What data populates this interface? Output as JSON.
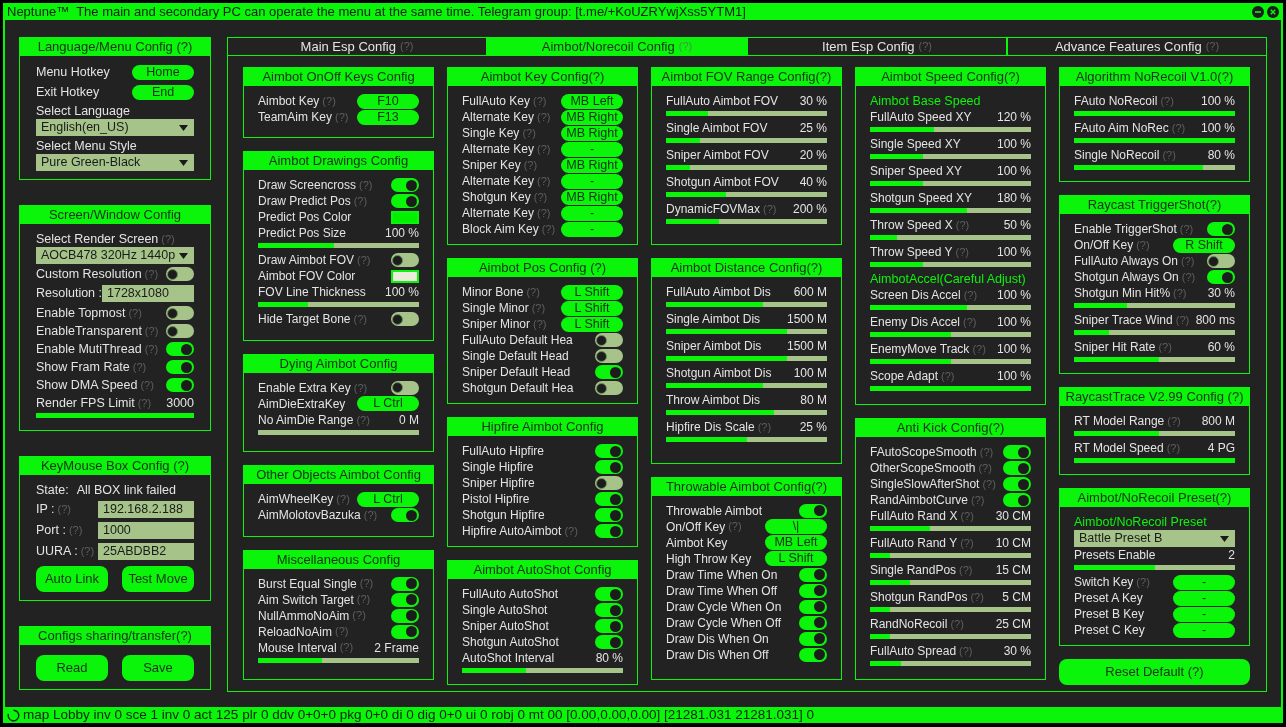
{
  "title_bar": {
    "text": "Neptune™  The main and secondary PC can operate the menu at the same time. Telegram group: [t.me/+KoUZRYwjXss5YTM1]"
  },
  "sidebar": {
    "panels": [
      {
        "title": "Language/Menu Config (?)",
        "rows": [
          {
            "kind": "key",
            "label": "Menu Hotkey",
            "value": "Home"
          },
          {
            "kind": "key",
            "label": "Exit Hotkey",
            "value": "End"
          },
          {
            "kind": "dropdown",
            "label": "Select Language",
            "value": "English(en_US)"
          },
          {
            "kind": "dropdown",
            "label": "Select Menu Style",
            "value": "Pure Green-Black"
          }
        ]
      },
      {
        "title": "Screen/Window Config",
        "rows": [
          {
            "kind": "dropdown",
            "label": "Select Render Screen",
            "hint": "(?)",
            "value": "AOCB478 320Hz 1440p"
          },
          {
            "kind": "toggle",
            "label": "Custom Resolution",
            "hint": "(?)",
            "on": false
          },
          {
            "kind": "field",
            "label": "Resolution :",
            "value": "1728x1080"
          },
          {
            "kind": "toggle",
            "label": "Enable Topmost",
            "hint": "(?)",
            "on": false
          },
          {
            "kind": "toggle",
            "label": "EnableTransparent",
            "hint": "(?)",
            "on": false
          },
          {
            "kind": "toggle",
            "label": "Enable MutiThread",
            "hint": "(?)",
            "on": true
          },
          {
            "kind": "toggle",
            "label": "Show Fram Rate",
            "hint": "(?)",
            "on": true
          },
          {
            "kind": "toggle",
            "label": "Show DMA Speed",
            "hint": "(?)",
            "on": true
          },
          {
            "kind": "slider",
            "label": "Render FPS Limit",
            "hint": "(?)",
            "reading": "3000",
            "level": 1
          }
        ]
      },
      {
        "title": "KeyMouse Box Config (?)",
        "rows": [
          {
            "kind": "text",
            "label": "State:",
            "value": "All BOX link failed"
          },
          {
            "kind": "field",
            "label": "IP :",
            "hint": "(?)",
            "value": "192.168.2.188"
          },
          {
            "kind": "field",
            "label": "Port :",
            "hint": "(?)",
            "value": "1000"
          },
          {
            "kind": "field",
            "label": "UURA :",
            "hint": "(?)",
            "value": "25ABDBB2"
          },
          {
            "kind": "buttons",
            "labels": [
              "Auto Link",
              "Test Move"
            ]
          }
        ]
      },
      {
        "title": "Configs sharing/transfer(?)",
        "rows": [
          {
            "kind": "buttons",
            "labels": [
              "Read",
              "Save"
            ]
          }
        ]
      }
    ]
  },
  "tabs": [
    {
      "label": "Main Esp Config",
      "hint": "(?)",
      "selected": false
    },
    {
      "label": "Aimbot/Norecoil Config",
      "hint": "(?)",
      "selected": true
    },
    {
      "label": "Item Esp Config",
      "hint": "(?)",
      "selected": false
    },
    {
      "label": "Advance Features Config",
      "hint": "(?)",
      "selected": false
    }
  ],
  "columns": [
    {
      "items": [
        {
          "kind": "panel",
          "title": "Aimbot OnOff Keys Config",
          "rows": [
            {
              "kind": "key",
              "label": "Aimbot Key",
              "hint": "(?)",
              "value": "F10"
            },
            {
              "kind": "key",
              "label": "TeamAim Key",
              "hint": "(?)",
              "value": "F13"
            }
          ]
        },
        {
          "kind": "panel",
          "title": "Aimbot Drawings Config",
          "rows": [
            {
              "kind": "toggle",
              "label": "Draw Screencross",
              "hint": "(?)",
              "on": true
            },
            {
              "kind": "toggle",
              "label": "Draw Predict Pos",
              "hint": "(?)",
              "on": true
            },
            {
              "kind": "color",
              "label": "Predict Pos Color",
              "color": "#00f000"
            },
            {
              "kind": "slider",
              "label": "Predict Pos Size",
              "reading": "100 %",
              "level": 0.47
            },
            {
              "kind": "toggle",
              "label": "Draw Aimbot FOV",
              "hint": "(?)",
              "on": false
            },
            {
              "kind": "color",
              "label": "Aimbot FOV Color",
              "color": "#ecebdc"
            },
            {
              "kind": "slider",
              "label": "FOV Line Thickness",
              "reading": "100 %",
              "level": 0.31
            },
            {
              "kind": "toggle",
              "label": "Hide Target Bone",
              "hint": "(?)",
              "on": false
            }
          ]
        },
        {
          "kind": "panel",
          "title": "Dying Aimbot Config",
          "rows": [
            {
              "kind": "toggle",
              "label": "Enable Extra Key",
              "hint": "(?)",
              "on": false
            },
            {
              "kind": "key",
              "label": "AimDieExtraKey",
              "value": "L Ctrl"
            },
            {
              "kind": "slider",
              "label": "No AimDie Range",
              "hint": "(?)",
              "reading": "0 M",
              "level": 0
            }
          ]
        },
        {
          "kind": "panel",
          "title": "Other Objects Aimbot Config",
          "rows": [
            {
              "kind": "key",
              "label": "AimWheelKey",
              "hint": "(?)",
              "value": "L Ctrl"
            },
            {
              "kind": "toggle",
              "label": "AimMolotovBazuka",
              "hint": "(?)",
              "on": true
            }
          ]
        },
        {
          "kind": "panel",
          "title": "Miscellaneous Config",
          "rows": [
            {
              "kind": "toggle",
              "label": "Burst Equal Single",
              "hint": "(?)",
              "on": true
            },
            {
              "kind": "toggle",
              "label": "Aim Switch Target",
              "hint": "(?)",
              "on": true
            },
            {
              "kind": "toggle",
              "label": "NullAmmoNoAim",
              "hint": "(?)",
              "on": true
            },
            {
              "kind": "toggle",
              "label": "ReloadNoAim",
              "hint": "(?)",
              "on": true
            },
            {
              "kind": "slider",
              "label": "Mouse Interval",
              "hint": "(?)",
              "reading": "2 Frame",
              "level": 0.4
            }
          ]
        }
      ]
    },
    {
      "items": [
        {
          "kind": "panel",
          "title": "Aimbot Key Config(?)",
          "rows": [
            {
              "kind": "key",
              "label": "FullAuto Key",
              "hint": "(?)",
              "value": "MB Left"
            },
            {
              "kind": "key",
              "label": "Alternate Key",
              "hint": "(?)",
              "value": "MB Right"
            },
            {
              "kind": "key",
              "label": "Single Key",
              "hint": "(?)",
              "value": "MB Right"
            },
            {
              "kind": "key",
              "label": "Alternate Key",
              "hint": "(?)",
              "value": "-"
            },
            {
              "kind": "key",
              "label": "Sniper Key",
              "hint": "(?)",
              "value": "MB Right"
            },
            {
              "kind": "key",
              "label": "Alternate Key",
              "hint": "(?)",
              "value": "-"
            },
            {
              "kind": "key",
              "label": "Shotgun Key",
              "hint": "(?)",
              "value": "MB Right"
            },
            {
              "kind": "key",
              "label": "Alternate Key",
              "hint": "(?)",
              "value": "-"
            },
            {
              "kind": "key",
              "label": "Block Aim Key",
              "hint": "(?)",
              "value": "-"
            }
          ]
        },
        {
          "kind": "panel",
          "title": "Aimbot Pos Config (?)",
          "rows": [
            {
              "kind": "key",
              "label": "Minor Bone",
              "hint": "(?)",
              "value": "L Shift"
            },
            {
              "kind": "key",
              "label": "Single Minor",
              "hint": "(?)",
              "value": "L Shift"
            },
            {
              "kind": "key",
              "label": "Sniper Minor",
              "hint": "(?)",
              "value": "L Shift"
            },
            {
              "kind": "toggle",
              "label": "FullAuto Default Hea",
              "on": false
            },
            {
              "kind": "toggle",
              "label": "Single Default Head",
              "on": false
            },
            {
              "kind": "toggle",
              "label": "Sniper Default Head",
              "on": true
            },
            {
              "kind": "toggle",
              "label": "Shotgun Default Hea",
              "on": false
            }
          ]
        },
        {
          "kind": "panel",
          "title": "Hipfire Aimbot Config",
          "rows": [
            {
              "kind": "toggle",
              "label": "FullAuto Hipfire",
              "on": true
            },
            {
              "kind": "toggle",
              "label": "Single Hipfire",
              "on": true
            },
            {
              "kind": "toggle",
              "label": "Sniper Hipfire",
              "on": false
            },
            {
              "kind": "toggle",
              "label": "Pistol Hipfire",
              "on": true
            },
            {
              "kind": "toggle",
              "label": "Shotgun Hipfire",
              "on": true
            },
            {
              "kind": "toggle",
              "label": "Hipfire AutoAimbot",
              "hint": "(?)",
              "on": true
            }
          ]
        },
        {
          "kind": "panel",
          "title": "Aimbot AutoShot Config",
          "rows": [
            {
              "kind": "toggle",
              "label": "FullAuto AutoShot",
              "on": true
            },
            {
              "kind": "toggle",
              "label": "Single AutoShot",
              "on": true
            },
            {
              "kind": "toggle",
              "label": "Sniper AutoShot",
              "on": true
            },
            {
              "kind": "toggle",
              "label": "Shotgun AutoShot",
              "on": true
            },
            {
              "kind": "slider",
              "label": "AutoShot Interval",
              "reading": "80 %",
              "level": 0.4
            }
          ]
        }
      ]
    },
    {
      "items": [
        {
          "kind": "panel",
          "title": "Aimbot FOV Range Config(?)",
          "rows": [
            {
              "kind": "slider",
              "label": "FullAuto Aimbot FOV",
              "reading": "30 %",
              "level": 0.26
            },
            {
              "kind": "slider",
              "label": "Single Aimbot FOV",
              "reading": "25 %",
              "level": 0.21
            },
            {
              "kind": "slider",
              "label": "Sniper Aimbot FOV",
              "reading": "20 %",
              "level": 0.15
            },
            {
              "kind": "slider",
              "label": "Shotgun Aimbot FOV",
              "reading": "40 %",
              "level": 0.37
            },
            {
              "kind": "slider",
              "label": "DynamicFOVMax",
              "hint": "(?)",
              "reading": "200 %",
              "level": 0.33
            }
          ]
        },
        {
          "kind": "panel",
          "title": "Aimbot Distance Config(?)",
          "rows": [
            {
              "kind": "slider",
              "label": "FullAuto Aimbot Dis",
              "reading": "600 M",
              "level": 0.6
            },
            {
              "kind": "slider",
              "label": "Single Aimbot Dis",
              "reading": "1500 M",
              "level": 0.75
            },
            {
              "kind": "slider",
              "label": "Sniper Aimbot Dis",
              "reading": "1500 M",
              "level": 0.75
            },
            {
              "kind": "slider",
              "label": "Shotgun Aimbot Dis",
              "reading": "100 M",
              "level": 0.6
            },
            {
              "kind": "slider",
              "label": "Throw Aimbot Dis",
              "reading": "80 M",
              "level": 0.67
            },
            {
              "kind": "slider",
              "label": "Hipfire Dis Scale",
              "hint": "(?)",
              "reading": "25 %",
              "level": 0.5
            }
          ]
        },
        {
          "kind": "panel",
          "title": "Throwable Aimbot Config(?)",
          "rows": [
            {
              "kind": "toggle",
              "label": "Throwable Aimbot",
              "on": true
            },
            {
              "kind": "key",
              "label": "On/Off Key",
              "hint": "(?)",
              "value": "\\|"
            },
            {
              "kind": "key",
              "label": "Aimbot Key",
              "value": "MB Left"
            },
            {
              "kind": "key",
              "label": "High Throw Key",
              "value": "L Shift"
            },
            {
              "kind": "toggle",
              "label": "Draw Time When On",
              "on": true
            },
            {
              "kind": "toggle",
              "label": "Draw Time When Off",
              "on": true
            },
            {
              "kind": "toggle",
              "label": "Draw Cycle When On",
              "on": true
            },
            {
              "kind": "toggle",
              "label": "Draw Cycle When Off",
              "on": true
            },
            {
              "kind": "toggle",
              "label": "Draw Dis When On",
              "on": true
            },
            {
              "kind": "toggle",
              "label": "Draw Dis When Off",
              "on": true
            }
          ]
        }
      ]
    },
    {
      "items": [
        {
          "kind": "panel",
          "title": "Aimbot Speed Config(?)",
          "rows": [
            {
              "kind": "section",
              "text": "Aimbot Base Speed"
            },
            {
              "kind": "slider",
              "label": "FullAuto Speed XY",
              "reading": "120 %",
              "level": 0.4
            },
            {
              "kind": "slider",
              "label": "Single Speed XY",
              "reading": "100 %",
              "level": 0.33
            },
            {
              "kind": "slider",
              "label": "Sniper Speed XY",
              "reading": "100 %",
              "level": 0.33
            },
            {
              "kind": "slider",
              "label": "Shotgun Speed XY",
              "reading": "180 %",
              "level": 0.6
            },
            {
              "kind": "slider",
              "label": "Throw Speed X",
              "hint": "(?)",
              "reading": "50 %",
              "level": 0.17
            },
            {
              "kind": "slider",
              "label": "Throw Speed Y",
              "hint": "(?)",
              "reading": "100 %",
              "level": 0.33
            },
            {
              "kind": "section",
              "text": "AimbotAccel(Careful Adjust)"
            },
            {
              "kind": "slider",
              "label": "Screen Dis Accel",
              "hint": "(?)",
              "reading": "100 %",
              "level": 0.6
            },
            {
              "kind": "slider",
              "label": "Enemy Dis Accel",
              "hint": "(?)",
              "reading": "100 %",
              "level": 0.5
            },
            {
              "kind": "slider",
              "label": "EnemyMove Track",
              "hint": "(?)",
              "reading": "100 %",
              "level": 0.5
            },
            {
              "kind": "slider",
              "label": "Scope Adapt",
              "hint": "(?)",
              "reading": "100 %",
              "level": 1
            }
          ]
        },
        {
          "kind": "panel",
          "title": "Anti Kick Config(?)",
          "rows": [
            {
              "kind": "toggle",
              "label": "FAutoScopeSmooth",
              "hint": "(?)",
              "on": true
            },
            {
              "kind": "toggle",
              "label": "OtherScopeSmooth",
              "hint": "(?)",
              "on": true
            },
            {
              "kind": "toggle",
              "label": "SingleSlowAfterShot",
              "hint": "(?)",
              "on": true
            },
            {
              "kind": "toggle",
              "label": "RandAimbotCurve",
              "hint": "(?)",
              "on": true
            },
            {
              "kind": "slider",
              "label": "FullAuto Rand X",
              "hint": "(?)",
              "reading": "30 CM",
              "level": 0.375
            },
            {
              "kind": "slider",
              "label": "FullAuto Rand Y",
              "hint": "(?)",
              "reading": "10 CM",
              "level": 0.125
            },
            {
              "kind": "slider",
              "label": "Single RandPos",
              "hint": "(?)",
              "reading": "15 CM",
              "level": 0.25
            },
            {
              "kind": "slider",
              "label": "Shotgun RandPos",
              "hint": "(?)",
              "reading": "5 CM",
              "level": 0.125
            },
            {
              "kind": "slider",
              "label": "RandNoRecoil",
              "hint": "(?)",
              "reading": "25 CM",
              "level": 0.125
            },
            {
              "kind": "slider",
              "label": "FullAuto Spread",
              "hint": "(?)",
              "reading": "30 %",
              "level": 0.19
            }
          ]
        }
      ]
    },
    {
      "items": [
        {
          "kind": "panel",
          "title": "Algorithm NoRecoil V1.0(?)",
          "rows": [
            {
              "kind": "slider",
              "label": "FAuto NoRecoil",
              "hint": "(?)",
              "reading": "100 %",
              "level": 1
            },
            {
              "kind": "slider",
              "label": "FAuto Aim NoRec",
              "hint": "(?)",
              "reading": "100 %",
              "level": 1
            },
            {
              "kind": "slider",
              "label": "Single NoRecoil",
              "hint": "(?)",
              "reading": "80 %",
              "level": 0.8
            }
          ]
        },
        {
          "kind": "panel",
          "title": "Raycast TriggerShot(?)",
          "rows": [
            {
              "kind": "toggle",
              "label": "Enable TriggerShot",
              "hint": "(?)",
              "on": true
            },
            {
              "kind": "key",
              "label": "On/Off Key",
              "hint": "(?)",
              "value": "R Shift"
            },
            {
              "kind": "toggle",
              "label": "FullAuto Always On",
              "hint": "(?)",
              "on": false
            },
            {
              "kind": "toggle",
              "label": "Shotgun Always On",
              "hint": "(?)",
              "on": true
            },
            {
              "kind": "slider",
              "label": "Shotgun Min Hit%",
              "hint": "(?)",
              "reading": "30 %",
              "level": 0.33
            },
            {
              "kind": "slider",
              "label": "Sniper Trace Wind",
              "hint": "(?)",
              "reading": "800 ms",
              "level": 0.22
            },
            {
              "kind": "slider",
              "label": "Sniper Hit Rate",
              "hint": "(?)",
              "reading": "60 %",
              "level": 0.53
            }
          ]
        },
        {
          "kind": "panel",
          "title": "RaycastTrace V2.99 Config (?)",
          "rows": [
            {
              "kind": "slider",
              "label": "RT Model Range",
              "hint": "(?)",
              "reading": "800 M",
              "level": 0.53
            },
            {
              "kind": "slider",
              "label": "RT Model Speed",
              "hint": "(?)",
              "reading": "4 PG",
              "level": 1
            }
          ]
        },
        {
          "kind": "panel",
          "title": "Aimbot/NoRecoil Preset(?)",
          "rows": [
            {
              "kind": "section",
              "text": "Aimbot/NoRecoil Preset"
            },
            {
              "kind": "dropdown",
              "value": "Battle Preset B"
            },
            {
              "kind": "slider",
              "label": "Presets Enable",
              "reading": "2",
              "level": 0.5
            },
            {
              "kind": "key",
              "label": "Switch Key",
              "hint": "(?)",
              "value": "-"
            },
            {
              "kind": "key",
              "label": "Preset A Key",
              "value": "-"
            },
            {
              "kind": "key",
              "label": "Preset B Key",
              "value": "-"
            },
            {
              "kind": "key",
              "label": "Preset C Key",
              "value": "-"
            }
          ]
        },
        {
          "kind": "button",
          "label": "Reset Default (?)"
        }
      ]
    }
  ],
  "status_bar": {
    "text": "map Lobby inv 0 sce 1 inv 0 act 125 plr 0 ddv 0+0+0 pkg 0+0 di 0 dig 0+0 ui 0 robj 0 mt 00 [0.00,0.00,0.00] [21281.031 21281.031] 0"
  }
}
